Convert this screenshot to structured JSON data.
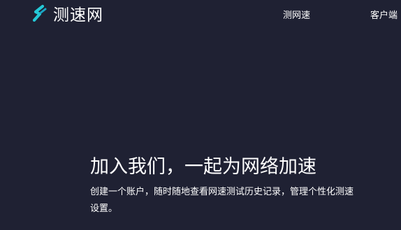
{
  "brand": {
    "name": "测速网",
    "logo_icon": "s-wave-logo-icon",
    "logo_color": "#24c8d6"
  },
  "nav": {
    "items": [
      {
        "label": "测网速"
      },
      {
        "label": "客户端"
      }
    ]
  },
  "hero": {
    "title": "加入我们，一起为网络加速",
    "description": "创建一个账户，随时随地查看网速测试历史记录，管理个性化测速设置。"
  },
  "colors": {
    "background": "#1f2133",
    "text": "#ffffff"
  }
}
